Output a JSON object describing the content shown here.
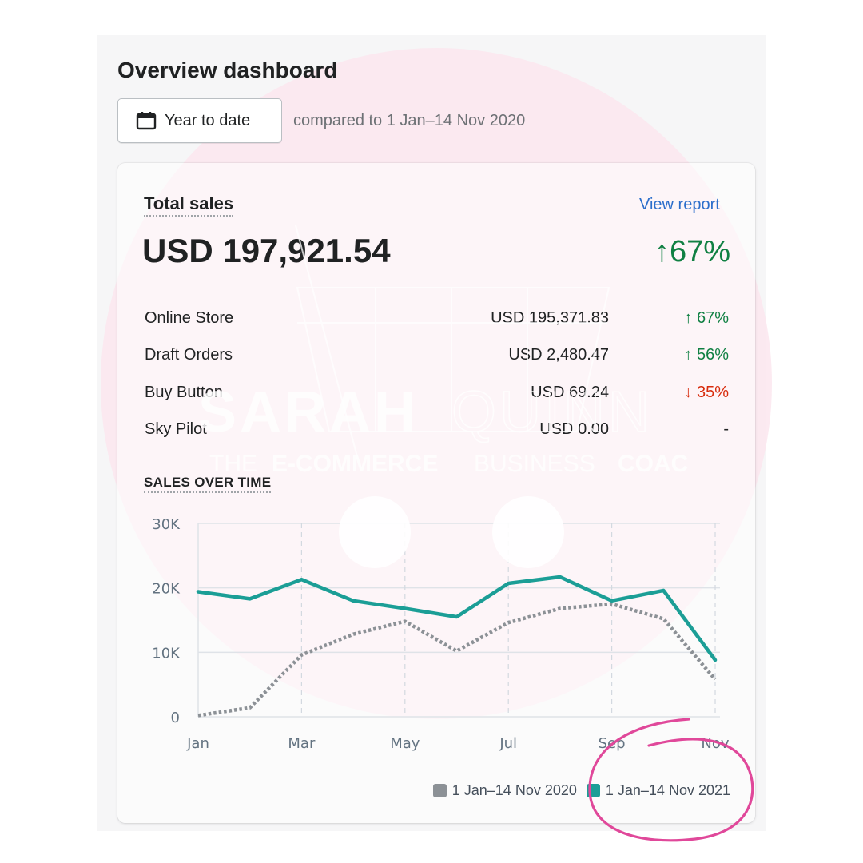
{
  "page": {
    "title": "Overview dashboard",
    "date_range_button": "Year to date",
    "comparison_text": "compared to 1 Jan–14 Nov 2020"
  },
  "total_sales": {
    "label": "Total sales",
    "view_report_link": "View report",
    "value": "USD 197,921.54",
    "change": "↑67%",
    "change_color": "#108043",
    "channels": [
      {
        "name": "Online Store",
        "value": "USD 195,371.83",
        "change": "↑ 67%",
        "trend": "up"
      },
      {
        "name": "Draft Orders",
        "value": "USD 2,480.47",
        "change": "↑ 56%",
        "trend": "up"
      },
      {
        "name": "Buy Button",
        "value": "USD 69.24",
        "change": "↓ 35%",
        "trend": "down"
      },
      {
        "name": "Sky Pilot",
        "value": "USD 0.00",
        "change": "-",
        "trend": "none"
      }
    ]
  },
  "sales_over_time": {
    "label": "SALES OVER TIME",
    "legend": [
      {
        "label": "1 Jan–14 Nov 2020",
        "color": "#8c9196"
      },
      {
        "label": "1 Jan–14 Nov 2021",
        "color": "#1b9e96"
      }
    ]
  },
  "chart_data": {
    "type": "line",
    "x": [
      "Jan",
      "Feb",
      "Mar",
      "Apr",
      "May",
      "Jun",
      "Jul",
      "Aug",
      "Sep",
      "Oct",
      "Nov"
    ],
    "x_tick_labels": [
      "Jan",
      "Mar",
      "May",
      "Jul",
      "Sep",
      "Nov"
    ],
    "y_tick_labels": [
      "0",
      "10K",
      "20K",
      "30K"
    ],
    "ylim": [
      0,
      30000
    ],
    "grid": true,
    "legend_position": "bottom-right",
    "series": [
      {
        "name": "1 Jan–14 Nov 2020",
        "color": "#8c9196",
        "style": "dotted",
        "values": [
          200,
          1400,
          9600,
          12800,
          14800,
          10200,
          14600,
          16800,
          17500,
          15200,
          5800
        ]
      },
      {
        "name": "1 Jan–14 Nov 2021",
        "color": "#1b9e96",
        "style": "solid",
        "values": [
          19400,
          18300,
          21300,
          18000,
          16800,
          15500,
          20700,
          21700,
          18000,
          19600,
          8800
        ]
      }
    ]
  },
  "watermark": {
    "name_part1": "SARAH",
    "name_part2": "QUINN",
    "tagline_part1": "THE",
    "tagline_part2": "E-COMMERCE",
    "tagline_part3": "BUSINESS",
    "tagline_part4": "COAC"
  },
  "annotation": {
    "color": "#e0489a"
  }
}
